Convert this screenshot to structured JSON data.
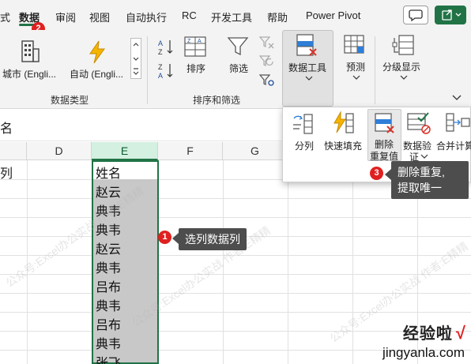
{
  "menubar": {
    "items": [
      "式",
      "数据",
      "审阅",
      "视图",
      "自动执行",
      "RC",
      "开发工具",
      "帮助",
      "Power Pivot"
    ],
    "active_index": 1
  },
  "ribbon": {
    "data_types": {
      "city_label": "城市 (Engli...",
      "auto_label": "自动 (Engli...",
      "group_label": "数据类型"
    },
    "sort_filter": {
      "sort_label": "排序",
      "filter_label": "筛选",
      "group_label": "排序和筛选"
    },
    "data_tools_label": "数据工具",
    "forecast_label": "预测",
    "outline_label": "分级显示"
  },
  "formula_bar": {
    "fragment": "名"
  },
  "grid": {
    "row_fragment": "列",
    "columns": [
      "D",
      "E",
      "F",
      "G"
    ],
    "cells": [
      "姓名",
      "赵云",
      "典韦",
      "典韦",
      "赵云",
      "典韦",
      "吕布",
      "典韦",
      "吕布",
      "典韦",
      "张飞"
    ]
  },
  "dropdown": {
    "split_label": "分列",
    "flash_fill_label": "快速填充",
    "remove_dup_line1": "删除",
    "remove_dup_line2": "重复值",
    "validation_line1": "数据验",
    "validation_line2": "证",
    "consolidate_label": "合并计算"
  },
  "callouts": [
    {
      "badge": "1",
      "text": "选列数据列"
    },
    {
      "badge": "2"
    },
    {
      "badge": "3",
      "line1": "删除重复,",
      "line2": "提取唯一"
    }
  ],
  "watermark": "公众号:Excel办公实战 作者:E精精",
  "brand": {
    "name": "经验啦",
    "check": "√",
    "url": "jingyanla.com"
  }
}
